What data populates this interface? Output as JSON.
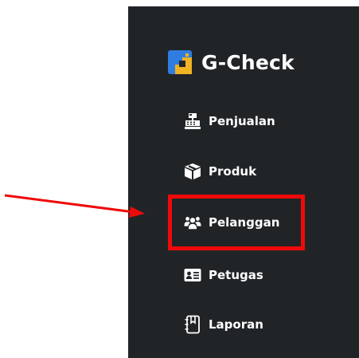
{
  "brand": {
    "title": "G-Check",
    "logo_icon": "g-check-logo",
    "logo_colors": [
      "#2f7de1",
      "#f0b323"
    ]
  },
  "nav": {
    "items": [
      {
        "label": "Penjualan",
        "icon": "cash-register-icon"
      },
      {
        "label": "Produk",
        "icon": "box-icon"
      },
      {
        "label": "Pelanggan",
        "icon": "users-icon"
      },
      {
        "label": "Petugas",
        "icon": "id-card-icon"
      },
      {
        "label": "Laporan",
        "icon": "notebook-icon"
      }
    ],
    "highlighted_item": "Pelanggan"
  },
  "annotation": {
    "highlight_color": "#ee0a0a",
    "arrow_color": "#ee0a0a"
  },
  "colors": {
    "sidebar_bg": "#212427",
    "text": "#ffffff"
  }
}
